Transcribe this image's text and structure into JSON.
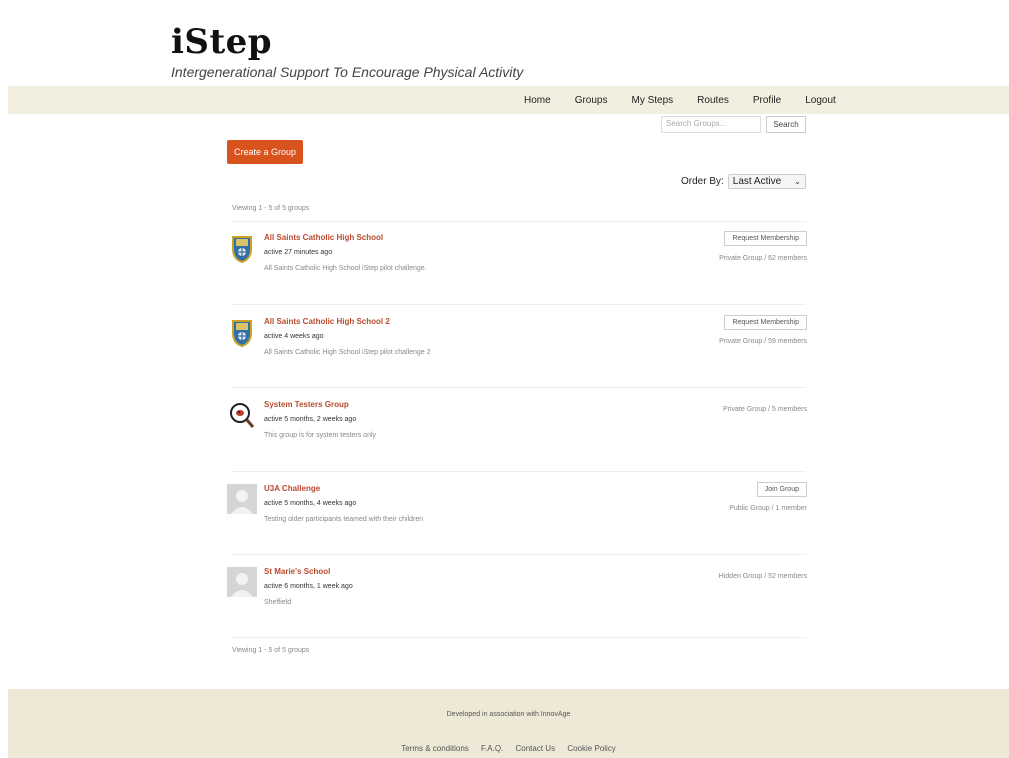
{
  "site": {
    "title": "iStep",
    "tagline": "Intergenerational Support To Encourage Physical Activity"
  },
  "nav": {
    "items": [
      {
        "label": "Home"
      },
      {
        "label": "Groups"
      },
      {
        "label": "My Steps"
      },
      {
        "label": "Routes"
      },
      {
        "label": "Profile"
      },
      {
        "label": "Logout"
      }
    ]
  },
  "search": {
    "placeholder": "Search Groups...",
    "button": "Search"
  },
  "create_group": "Create a Group",
  "order_by": {
    "label": "Order By:",
    "selected": "Last Active"
  },
  "viewing_top": "Viewing 1 - 5 of 5 groups",
  "viewing_bottom": "Viewing 1 - 5 of 5 groups",
  "groups": [
    {
      "name": "All Saints Catholic High School",
      "active": "active 27 minutes ago",
      "description": "All Saints Catholic High School iStep pilot challenge.",
      "button": "Request Membership",
      "meta": "Private Group / 62 members",
      "avatar": "school-crest-icon"
    },
    {
      "name": "All Saints Catholic High School 2",
      "active": "active 4 weeks ago",
      "description": "All Saints Catholic High School iStep pilot challenge 2",
      "button": "Request Membership",
      "meta": "Private Group / 59 members",
      "avatar": "school-crest-icon"
    },
    {
      "name": "System Testers Group",
      "active": "active 5 months, 2 weeks ago",
      "description": "This group is for system testers only",
      "button": "",
      "meta": "Private Group / 5 members",
      "avatar": "bug-magnifier-icon"
    },
    {
      "name": "U3A Challenge",
      "active": "active 5 months, 4 weeks ago",
      "description": "Testing older participants teamed with their children",
      "button": "Join Group",
      "meta": "Public Group / 1 member",
      "avatar": "default-avatar-icon"
    },
    {
      "name": "St Marie's School",
      "active": "active 6 months, 1 week ago",
      "description": "Sheffield",
      "button": "",
      "meta": "Hidden Group / 52 members",
      "avatar": "default-avatar-icon"
    }
  ],
  "footer": {
    "credit": "Developed in association with InnovAge",
    "links": [
      {
        "label": "Terms & conditions"
      },
      {
        "label": "F.A.Q."
      },
      {
        "label": "Contact Us"
      },
      {
        "label": "Cookie Policy"
      }
    ]
  },
  "colors": {
    "accent": "#d9531e",
    "link": "#b94a2e",
    "band": "#f2efe0",
    "footer": "#ede9d6"
  }
}
